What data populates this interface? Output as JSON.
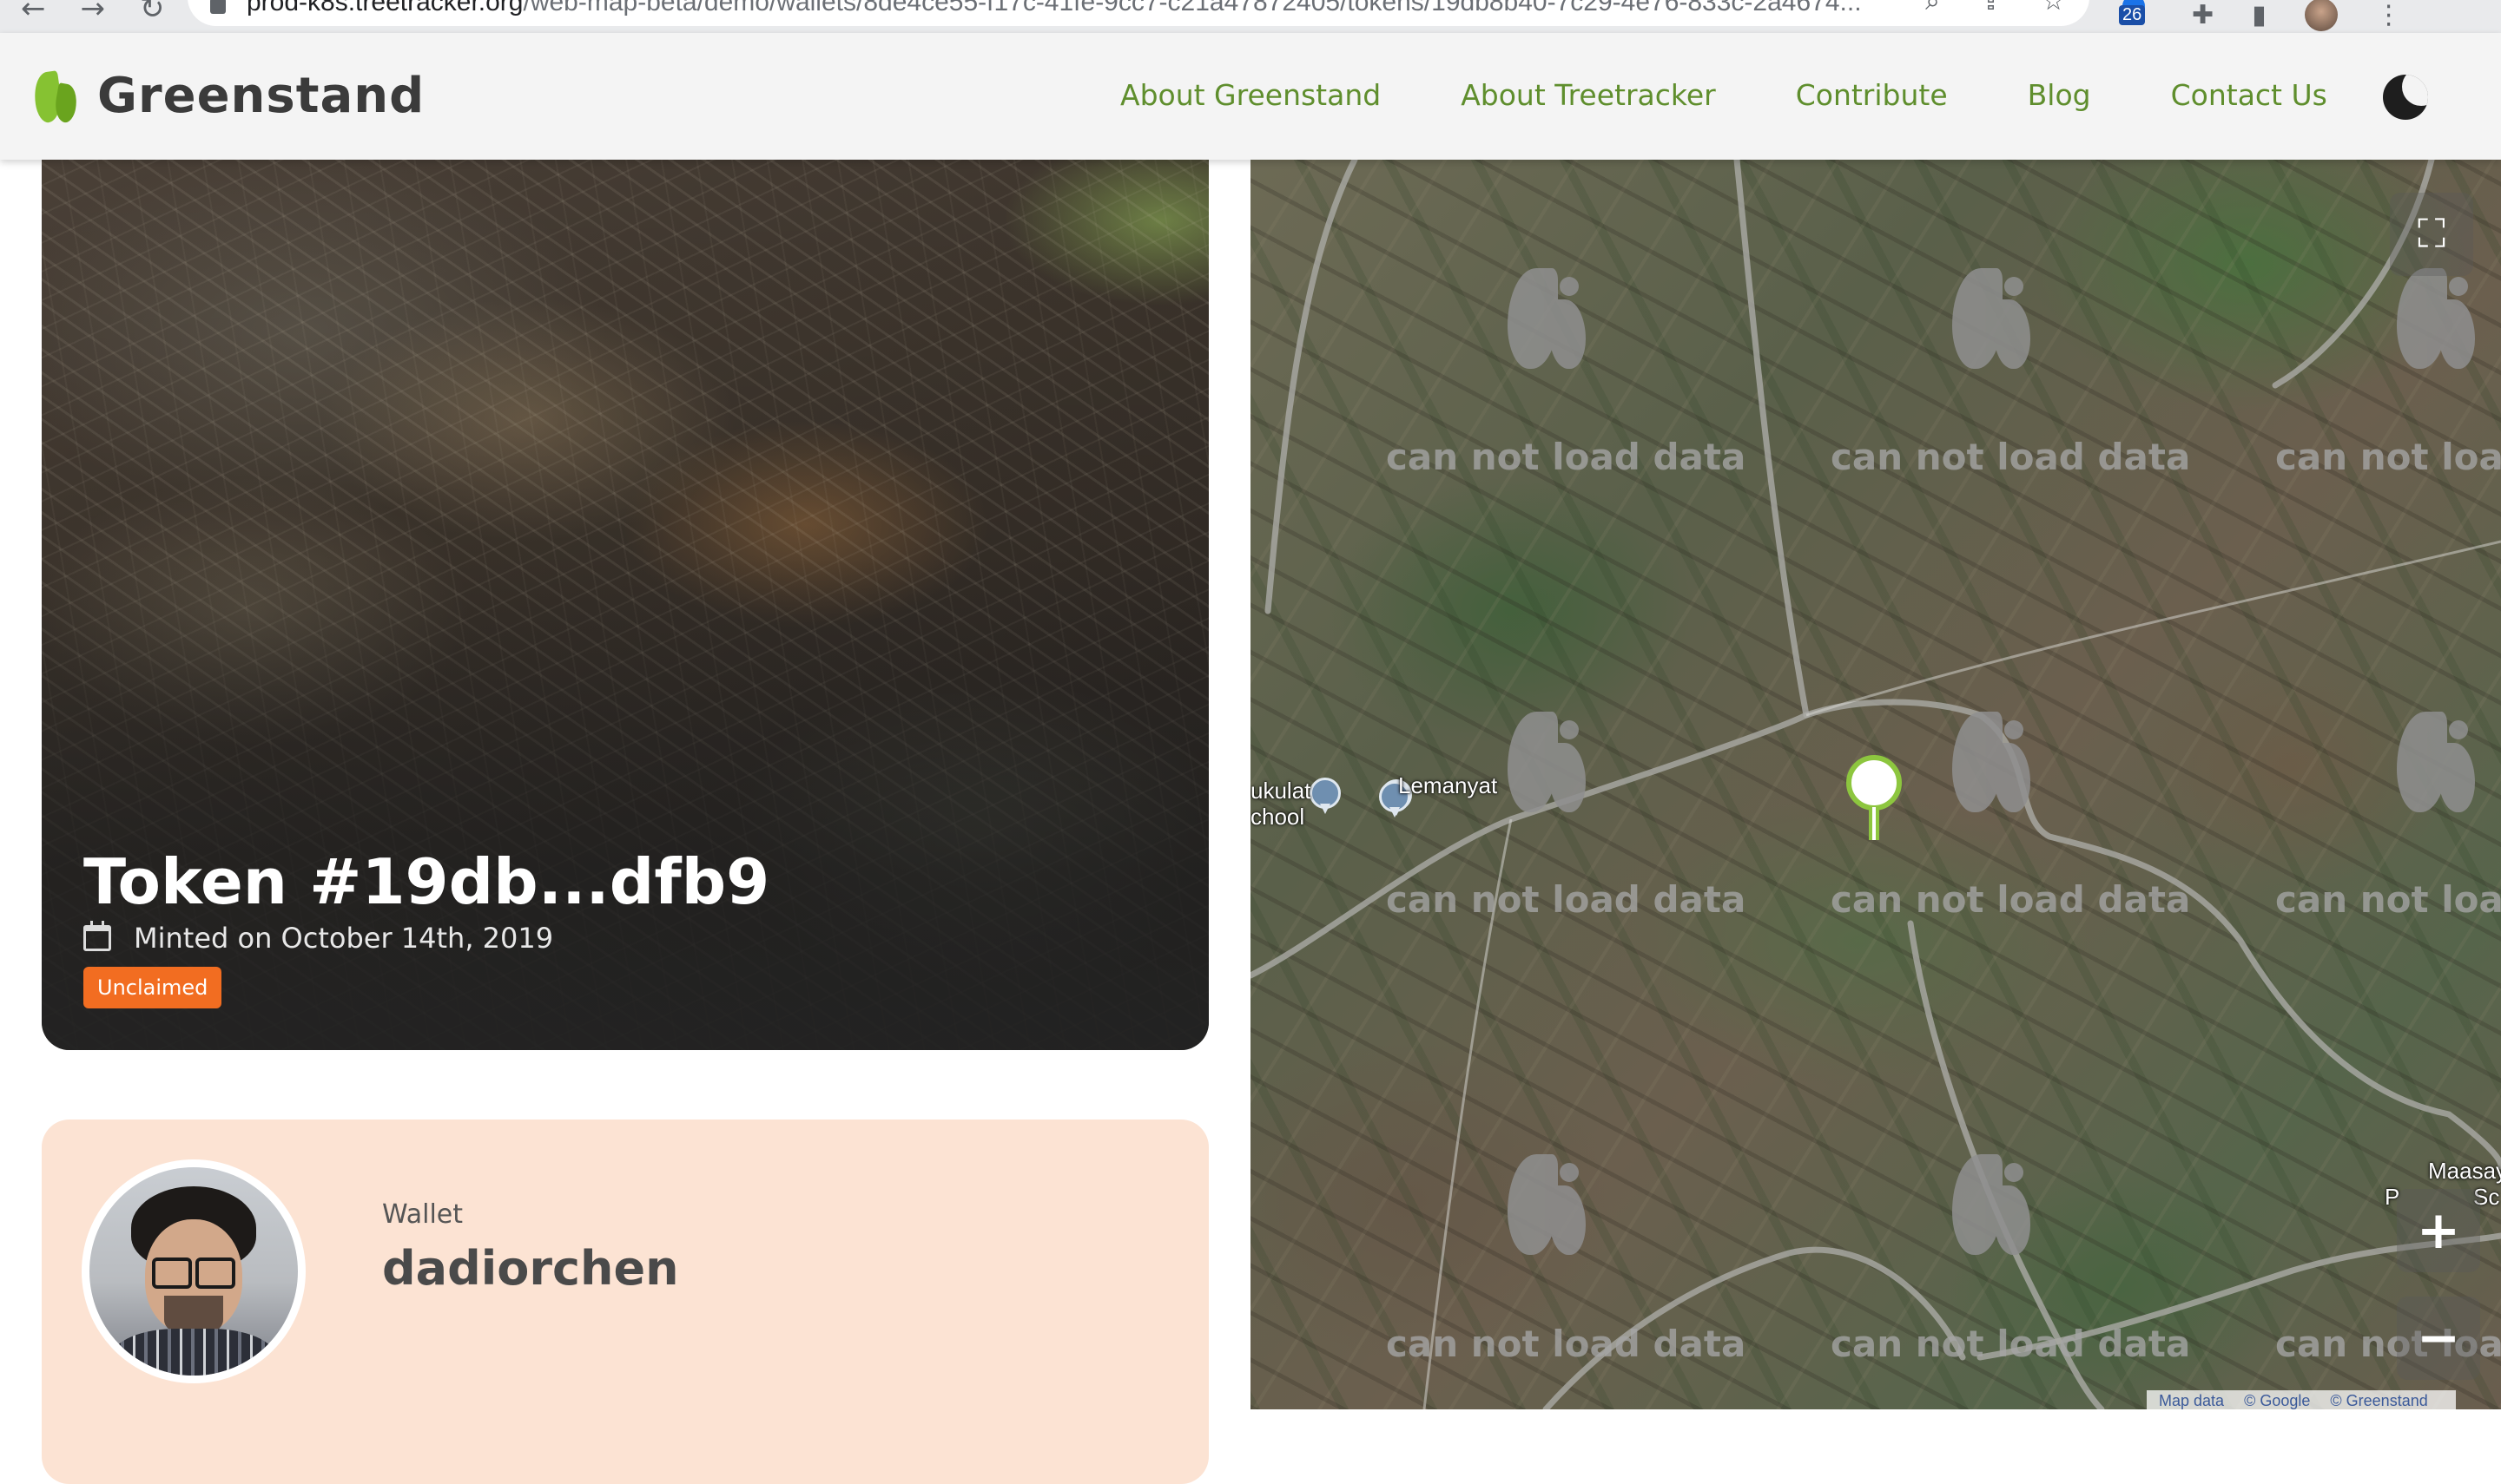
{
  "browser": {
    "url_prefix": "prod-k8s.treetracker.org",
    "url_path": "/web-map-beta/demo/wallets/8de4ce55-f17c-41fe-9cc7-c21a47872405/tokens/19db8b40-7c29-4e76-833c-2a4674...",
    "extension_badge": "26"
  },
  "navbar": {
    "brand": "Greenstand",
    "links": [
      "About Greenstand",
      "About Treetracker",
      "Contribute",
      "Blog",
      "Contact Us"
    ]
  },
  "token": {
    "title": "Token #19db...dfb9",
    "minted": "Minted on October 14th, 2019",
    "status": "Unclaimed"
  },
  "wallet": {
    "label": "Wallet",
    "name": "dadiorchen"
  },
  "map": {
    "tile_error": "can not load data",
    "places": [
      "Lemanyat",
      "ukulat",
      "chool",
      "Maasay",
      "P",
      "Sc"
    ],
    "zoom_in": "+",
    "zoom_out": "−",
    "attribution": [
      "Map data",
      "© Google",
      "© Greenstand"
    ]
  },
  "colors": {
    "accent": "#5f8e2d",
    "badge": "#f26d21",
    "wallet_bg": "#fce3d3"
  },
  "icons": [
    "back-icon",
    "forward-icon",
    "reload-icon",
    "lock-icon",
    "search-icon",
    "share-icon",
    "star-icon",
    "extension-icon",
    "puzzle-icon",
    "sidebar-icon",
    "menu-icon",
    "moon-icon",
    "calendar-icon",
    "fullscreen-icon"
  ]
}
